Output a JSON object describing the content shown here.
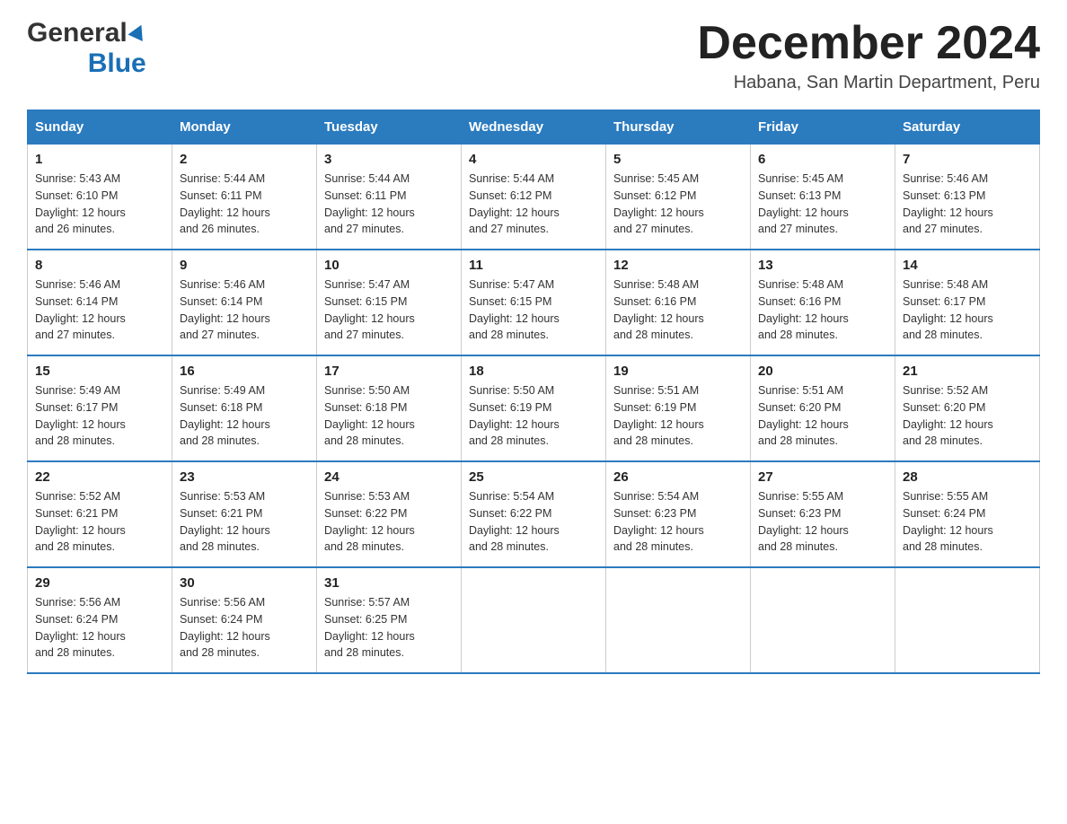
{
  "header": {
    "logo_general": "General",
    "logo_blue": "Blue",
    "title": "December 2024",
    "subtitle": "Habana, San Martin Department, Peru"
  },
  "calendar": {
    "days_of_week": [
      "Sunday",
      "Monday",
      "Tuesday",
      "Wednesday",
      "Thursday",
      "Friday",
      "Saturday"
    ],
    "weeks": [
      [
        {
          "day": "1",
          "sunrise": "5:43 AM",
          "sunset": "6:10 PM",
          "daylight": "12 hours and 26 minutes."
        },
        {
          "day": "2",
          "sunrise": "5:44 AM",
          "sunset": "6:11 PM",
          "daylight": "12 hours and 26 minutes."
        },
        {
          "day": "3",
          "sunrise": "5:44 AM",
          "sunset": "6:11 PM",
          "daylight": "12 hours and 27 minutes."
        },
        {
          "day": "4",
          "sunrise": "5:44 AM",
          "sunset": "6:12 PM",
          "daylight": "12 hours and 27 minutes."
        },
        {
          "day": "5",
          "sunrise": "5:45 AM",
          "sunset": "6:12 PM",
          "daylight": "12 hours and 27 minutes."
        },
        {
          "day": "6",
          "sunrise": "5:45 AM",
          "sunset": "6:13 PM",
          "daylight": "12 hours and 27 minutes."
        },
        {
          "day": "7",
          "sunrise": "5:46 AM",
          "sunset": "6:13 PM",
          "daylight": "12 hours and 27 minutes."
        }
      ],
      [
        {
          "day": "8",
          "sunrise": "5:46 AM",
          "sunset": "6:14 PM",
          "daylight": "12 hours and 27 minutes."
        },
        {
          "day": "9",
          "sunrise": "5:46 AM",
          "sunset": "6:14 PM",
          "daylight": "12 hours and 27 minutes."
        },
        {
          "day": "10",
          "sunrise": "5:47 AM",
          "sunset": "6:15 PM",
          "daylight": "12 hours and 27 minutes."
        },
        {
          "day": "11",
          "sunrise": "5:47 AM",
          "sunset": "6:15 PM",
          "daylight": "12 hours and 28 minutes."
        },
        {
          "day": "12",
          "sunrise": "5:48 AM",
          "sunset": "6:16 PM",
          "daylight": "12 hours and 28 minutes."
        },
        {
          "day": "13",
          "sunrise": "5:48 AM",
          "sunset": "6:16 PM",
          "daylight": "12 hours and 28 minutes."
        },
        {
          "day": "14",
          "sunrise": "5:48 AM",
          "sunset": "6:17 PM",
          "daylight": "12 hours and 28 minutes."
        }
      ],
      [
        {
          "day": "15",
          "sunrise": "5:49 AM",
          "sunset": "6:17 PM",
          "daylight": "12 hours and 28 minutes."
        },
        {
          "day": "16",
          "sunrise": "5:49 AM",
          "sunset": "6:18 PM",
          "daylight": "12 hours and 28 minutes."
        },
        {
          "day": "17",
          "sunrise": "5:50 AM",
          "sunset": "6:18 PM",
          "daylight": "12 hours and 28 minutes."
        },
        {
          "day": "18",
          "sunrise": "5:50 AM",
          "sunset": "6:19 PM",
          "daylight": "12 hours and 28 minutes."
        },
        {
          "day": "19",
          "sunrise": "5:51 AM",
          "sunset": "6:19 PM",
          "daylight": "12 hours and 28 minutes."
        },
        {
          "day": "20",
          "sunrise": "5:51 AM",
          "sunset": "6:20 PM",
          "daylight": "12 hours and 28 minutes."
        },
        {
          "day": "21",
          "sunrise": "5:52 AM",
          "sunset": "6:20 PM",
          "daylight": "12 hours and 28 minutes."
        }
      ],
      [
        {
          "day": "22",
          "sunrise": "5:52 AM",
          "sunset": "6:21 PM",
          "daylight": "12 hours and 28 minutes."
        },
        {
          "day": "23",
          "sunrise": "5:53 AM",
          "sunset": "6:21 PM",
          "daylight": "12 hours and 28 minutes."
        },
        {
          "day": "24",
          "sunrise": "5:53 AM",
          "sunset": "6:22 PM",
          "daylight": "12 hours and 28 minutes."
        },
        {
          "day": "25",
          "sunrise": "5:54 AM",
          "sunset": "6:22 PM",
          "daylight": "12 hours and 28 minutes."
        },
        {
          "day": "26",
          "sunrise": "5:54 AM",
          "sunset": "6:23 PM",
          "daylight": "12 hours and 28 minutes."
        },
        {
          "day": "27",
          "sunrise": "5:55 AM",
          "sunset": "6:23 PM",
          "daylight": "12 hours and 28 minutes."
        },
        {
          "day": "28",
          "sunrise": "5:55 AM",
          "sunset": "6:24 PM",
          "daylight": "12 hours and 28 minutes."
        }
      ],
      [
        {
          "day": "29",
          "sunrise": "5:56 AM",
          "sunset": "6:24 PM",
          "daylight": "12 hours and 28 minutes."
        },
        {
          "day": "30",
          "sunrise": "5:56 AM",
          "sunset": "6:24 PM",
          "daylight": "12 hours and 28 minutes."
        },
        {
          "day": "31",
          "sunrise": "5:57 AM",
          "sunset": "6:25 PM",
          "daylight": "12 hours and 28 minutes."
        },
        null,
        null,
        null,
        null
      ]
    ]
  },
  "labels": {
    "sunrise_prefix": "Sunrise: ",
    "sunset_prefix": "Sunset: ",
    "daylight_prefix": "Daylight: "
  }
}
